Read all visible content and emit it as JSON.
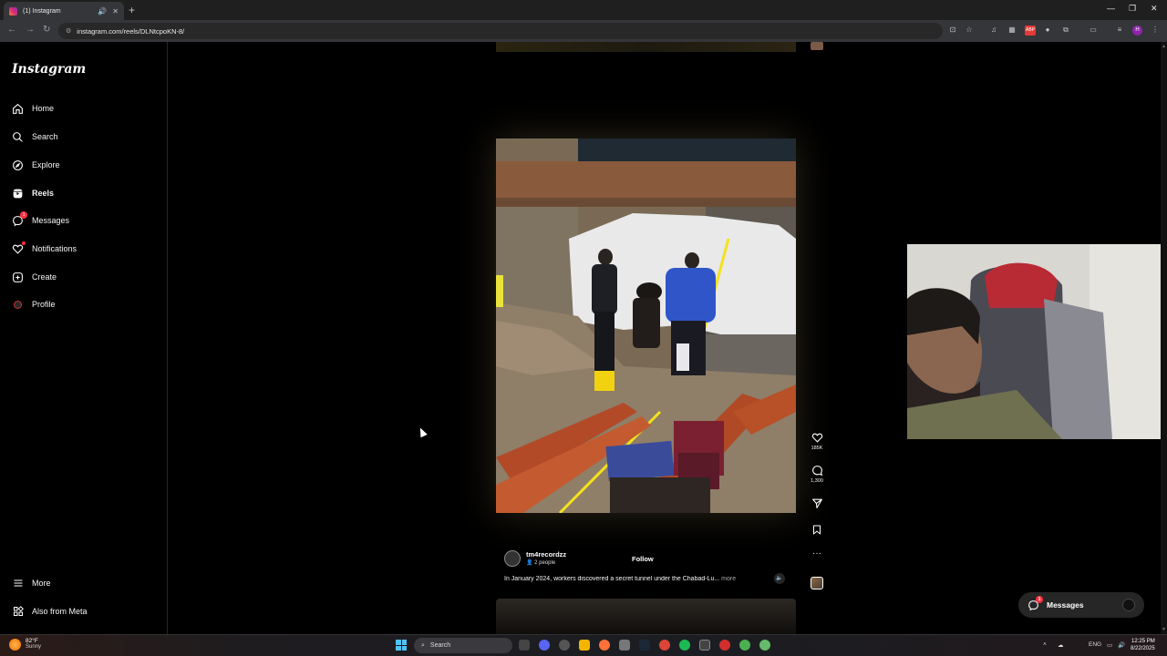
{
  "browser": {
    "tab_title": "(1) Instagram",
    "url": "instagram.com/reels/DLNtcpoKN-8/",
    "new_tab": "+",
    "tab_close": "✕",
    "tab_audio": "🔊"
  },
  "sidebar": {
    "logo": "Instagram",
    "items": [
      {
        "label": "Home",
        "icon": "home-icon"
      },
      {
        "label": "Search",
        "icon": "search-icon"
      },
      {
        "label": "Explore",
        "icon": "compass-icon"
      },
      {
        "label": "Reels",
        "icon": "reels-icon"
      },
      {
        "label": "Messages",
        "icon": "messenger-icon",
        "badge": "1"
      },
      {
        "label": "Notifications",
        "icon": "heart-icon"
      },
      {
        "label": "Create",
        "icon": "plus-square-icon"
      },
      {
        "label": "Profile",
        "icon": "avatar-icon"
      }
    ],
    "more": "More",
    "also_from_meta": "Also from Meta"
  },
  "reel": {
    "likes": "185K",
    "comments": "1,300",
    "username": "tm4recordzz",
    "people": "2 people",
    "follow": "Follow",
    "caption": "In January 2024, workers discovered a secret tunnel under the Chabad-Lu...",
    "more": "more"
  },
  "messages_pill": {
    "label": "Messages",
    "badge": "1"
  },
  "taskbar": {
    "temp": "82°F",
    "weather": "Sunny",
    "search": "Search",
    "lang": "ENG",
    "time": "12:25 PM",
    "date": "8/22/2025"
  },
  "colors": {
    "background": "#000000",
    "notification_red": "#ff3040",
    "divider": "#262626"
  }
}
